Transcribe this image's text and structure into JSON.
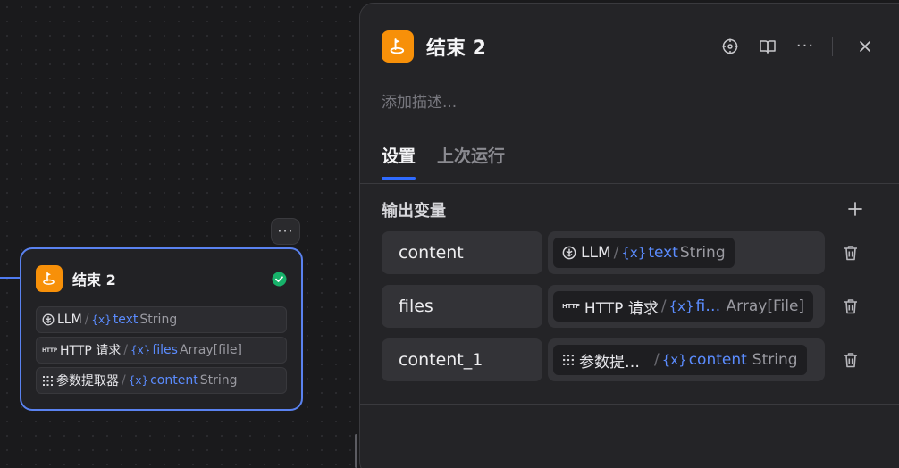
{
  "node": {
    "title": "结束 2",
    "more_label": "···",
    "rows": [
      {
        "source": "LLM",
        "slash": "/",
        "brace": "{x}",
        "var": "text",
        "type": "String"
      },
      {
        "source": "HTTP 请求",
        "slash": "/",
        "brace": "{x}",
        "var": "files",
        "type": "Array[file]"
      },
      {
        "source": "参数提取器",
        "slash": "/",
        "brace": "{x}",
        "var": "content",
        "type": "String"
      }
    ]
  },
  "panel": {
    "title": "结束 2",
    "description_placeholder": "添加描述...",
    "more_label": "···",
    "tabs": [
      {
        "label": "设置",
        "active": true
      },
      {
        "label": "上次运行",
        "active": false
      }
    ],
    "section_title": "输出变量",
    "outputs": [
      {
        "name": "content",
        "source": "LLM",
        "slash": "/",
        "brace": "{x}",
        "var": "text",
        "type": "String"
      },
      {
        "name": "files",
        "source": "HTTP 请求",
        "slash": "/",
        "brace": "{x}",
        "var": "files",
        "type": "Array[File]"
      },
      {
        "name": "content_1",
        "source": "参数提取器",
        "slash": "/",
        "brace": "{x}",
        "var": "content",
        "type": "String"
      }
    ]
  },
  "http_icon_text": "HTTP",
  "colors": {
    "accent": "#2f6bff",
    "variable": "#5b8cff",
    "app_icon": "#f79009",
    "success": "#17b26a",
    "node_border": "#5a82f0"
  },
  "icons": {
    "app": "end-node-icon",
    "status": "check-circle-icon",
    "locate": "crosshair-icon",
    "docs": "book-open-icon",
    "close": "close-icon",
    "add": "plus-icon",
    "delete": "trash-icon",
    "llm": "llm-icon",
    "http": "http-icon",
    "extractor": "grid-icon"
  }
}
